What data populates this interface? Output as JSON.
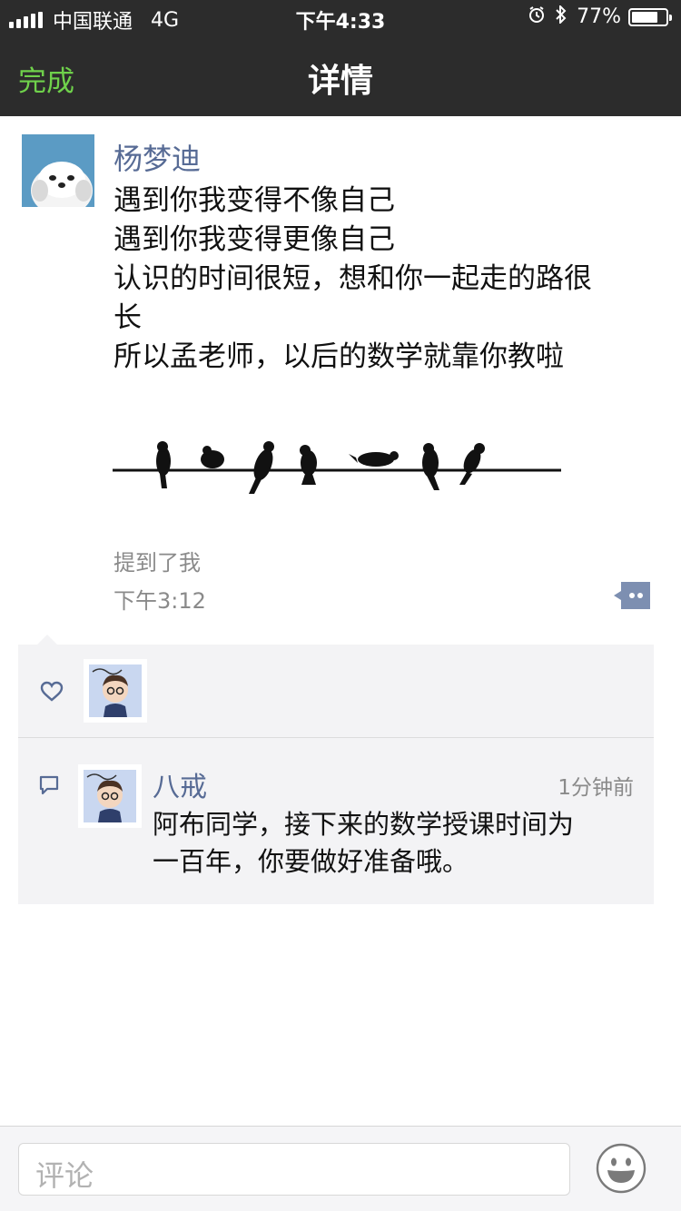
{
  "status_bar": {
    "carrier": "中国联通",
    "network": "4G",
    "time": "下午4:33",
    "battery": "77%",
    "battery_level": 0.77,
    "icons": [
      "alarm-icon",
      "bluetooth-icon"
    ]
  },
  "nav": {
    "done_label": "完成",
    "title": "详情",
    "done_color": "#6fd14b"
  },
  "post": {
    "author": "杨梦迪",
    "lines": [
      "遇到你我变得不像自己",
      "遇到你我变得更像自己",
      "认识的时间很短，想和你一起走的路很",
      "长",
      "所以孟老师，以后的数学就靠你教啦"
    ],
    "mention": "提到了我",
    "time": "下午3:12",
    "name_color": "#576b95"
  },
  "likes": {
    "icon": "heart-icon"
  },
  "comments": [
    {
      "author": "八戒",
      "time": "1分钟前",
      "lines": [
        "阿布同学，接下来的数学授课时间为",
        "一百年，你要做好准备哦。"
      ]
    }
  ],
  "bottom_bar": {
    "placeholder": "评论",
    "emoji_icon": "smiley-icon"
  }
}
